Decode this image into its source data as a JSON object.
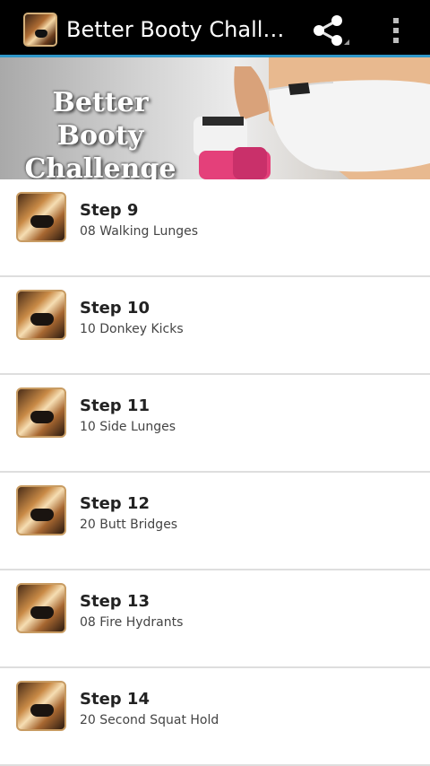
{
  "header": {
    "app_icon": "app-icon",
    "title": "Better Booty Challen...",
    "share_icon": "share-icon",
    "overflow_icon": "overflow-menu-icon"
  },
  "banner": {
    "title_line1": "Better Booty",
    "title_line2": "Challenge"
  },
  "items": [
    {
      "title": "Step 9",
      "subtitle": "08 Walking Lunges"
    },
    {
      "title": "Step 10",
      "subtitle": "10 Donkey Kicks"
    },
    {
      "title": "Step 11",
      "subtitle": "10 Side Lunges"
    },
    {
      "title": "Step 12",
      "subtitle": "20 Butt Bridges"
    },
    {
      "title": "Step 13",
      "subtitle": "08 Fire Hydrants"
    },
    {
      "title": "Step 14",
      "subtitle": "20 Second Squat Hold"
    }
  ],
  "colors": {
    "actionbar": "#000000",
    "accent_line": "#2f97c9",
    "divider": "#dedede"
  }
}
